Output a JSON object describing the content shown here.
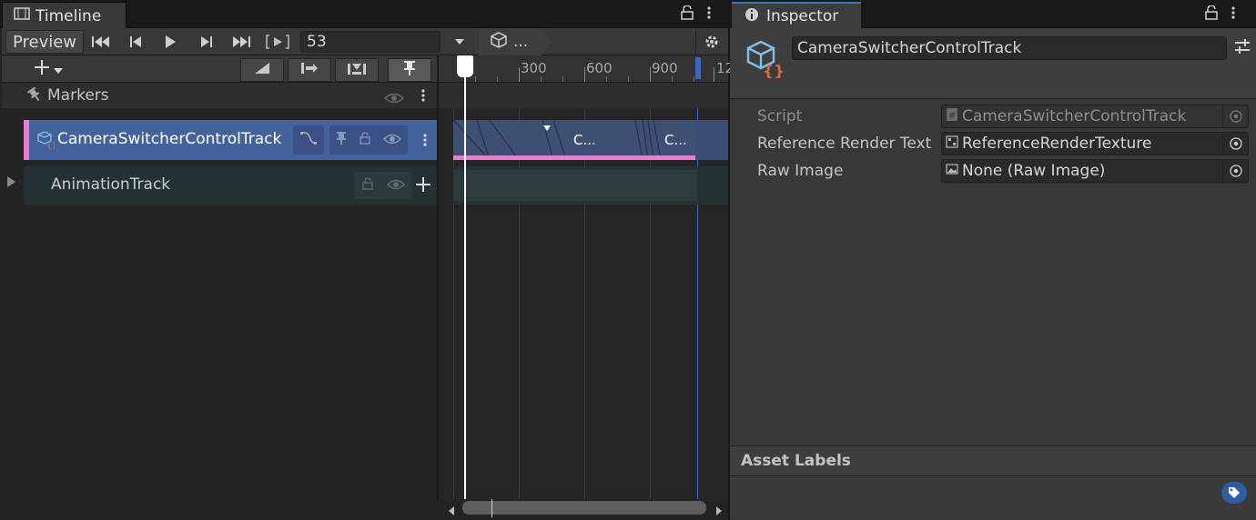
{
  "timeline": {
    "tab_title": "Timeline",
    "preview_label": "Preview",
    "frame_value": "53",
    "breadcrumb_label": "...",
    "markers_label": "Markers",
    "ruler_labels": [
      "300",
      "600",
      "900",
      "12"
    ],
    "tracks": [
      {
        "name": "CameraSwitcherControlTrack",
        "clips": [
          "C...",
          "C..."
        ]
      },
      {
        "name": "AnimationTrack"
      }
    ]
  },
  "inspector": {
    "tab_title": "Inspector",
    "object_name": "CameraSwitcherControlTrack",
    "properties": [
      {
        "label": "Script",
        "value": "CameraSwitcherControlTrack"
      },
      {
        "label": "Reference Render Text",
        "value": "ReferenceRenderTexture"
      },
      {
        "label": "Raw Image",
        "value": "None (Raw Image)"
      }
    ],
    "asset_labels_title": "Asset Labels"
  },
  "colors": {
    "selected_track": "#44629b",
    "track_accent": "#e77dcd",
    "animation_track": "#233333",
    "inspector_tab_accent": "#3a79bb"
  }
}
